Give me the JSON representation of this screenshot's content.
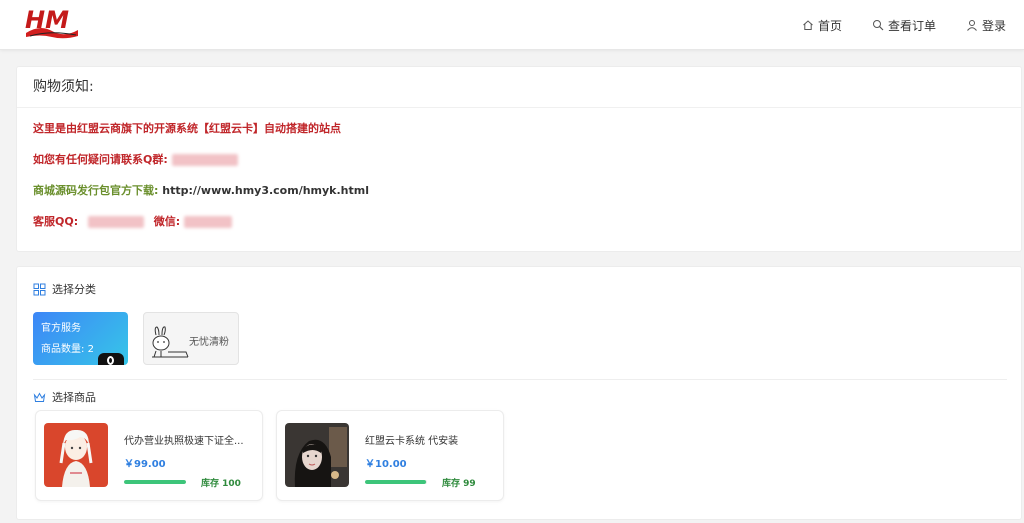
{
  "brand": {
    "logo_text": "HM"
  },
  "nav": {
    "home": "首页",
    "orders": "查看订单",
    "login": "登录"
  },
  "notice": {
    "title": "购物须知:",
    "line1": "这里是由红盟云商旗下的开源系统【红盟云卡】自动搭建的站点",
    "line2_label": "如您有任何疑问请联系Q群:",
    "line3_label": "商城源码发行包官方下载:",
    "line3_url": "http://www.hmy3.com/hmyk.html",
    "line4_qq_label": "客服QQ:",
    "line4_wechat_label": "微信:"
  },
  "categories": {
    "title": "选择分类",
    "items": [
      {
        "name": "官方服务",
        "count_label": "商品数量:",
        "count": "2",
        "active": true
      },
      {
        "name": "无忧清粉",
        "active": false
      }
    ]
  },
  "products": {
    "title": "选择商品",
    "items": [
      {
        "name": "代办营业执照极速下证全...",
        "price": "￥99.00",
        "stock_label": "库存 100",
        "stock_fill": 1.0
      },
      {
        "name": "红盟云卡系统 代安装",
        "price": "￥10.00",
        "stock_label": "库存 99",
        "stock_fill": 0.99
      }
    ]
  },
  "colors": {
    "accent_blue": "#2f7fe0",
    "notice_red": "#c0262a",
    "notice_green": "#6a8f2c",
    "stock_green": "#3dc57a"
  }
}
